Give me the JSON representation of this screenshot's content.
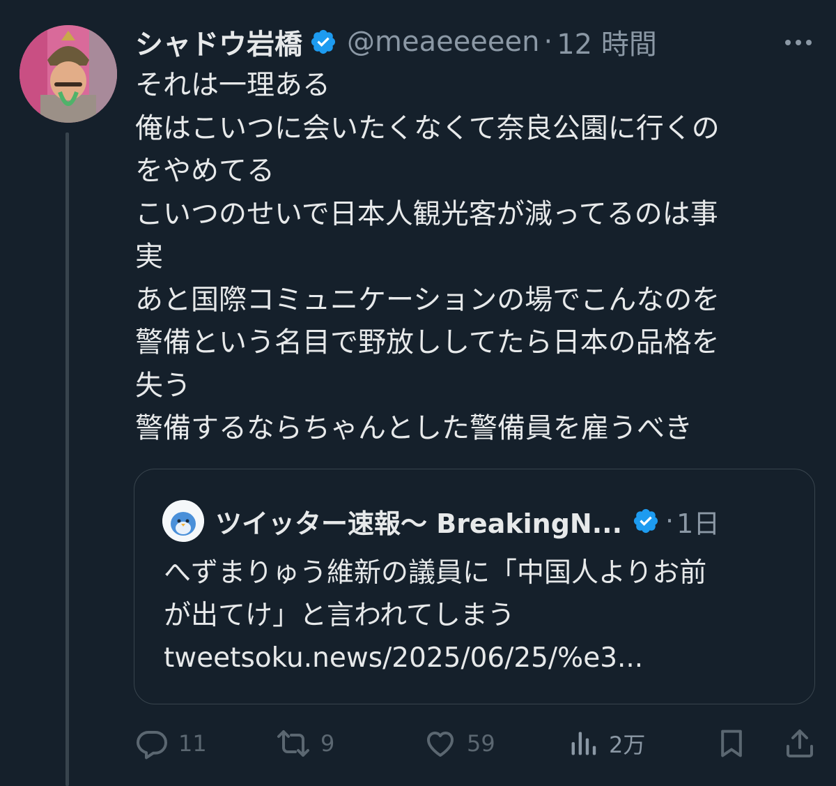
{
  "tweet": {
    "author": {
      "display_name": "シャドウ岩橋",
      "handle": "@meaeeeeen",
      "verified": true
    },
    "separator": "·",
    "time": "12 時間",
    "more_icon": "more-horizontal-icon",
    "text_lines": [
      "それは一理ある",
      "俺はこいつに会いたくなくて奈良公園に行くの",
      "をやめてる",
      "こいつのせいで日本人観光客が減ってるのは事",
      "実",
      "あと国際コミュニケーションの場でこんなのを",
      "警備という名目で野放ししてたら日本の品格を",
      "失う",
      "警備するならちゃんとした警備員を雇うべき"
    ]
  },
  "quoted_tweet": {
    "author": {
      "display_name": "ツイッター速報〜 BreakingN...",
      "verified": true
    },
    "separator": "·",
    "time": "1日",
    "text_lines": [
      "へずまりゅう維新の議員に「中国人よりお前",
      "が出てけ」と言われてしまう",
      "tweetsoku.news/2025/06/25/%e3..."
    ]
  },
  "actions": {
    "reply": {
      "icon": "reply-icon",
      "count": "11"
    },
    "retweet": {
      "icon": "retweet-icon",
      "count": "9"
    },
    "like": {
      "icon": "heart-icon",
      "count": "59"
    },
    "views": {
      "icon": "views-icon",
      "count": "2万"
    },
    "bookmark": {
      "icon": "bookmark-icon"
    },
    "share": {
      "icon": "share-icon"
    }
  },
  "colors": {
    "background": "#15202b",
    "text": "#e7e9ea",
    "secondary_text": "#8b98a5",
    "muted_icon": "#5b6771",
    "border": "#38444d",
    "verified_badge": "#1d9bf0"
  }
}
